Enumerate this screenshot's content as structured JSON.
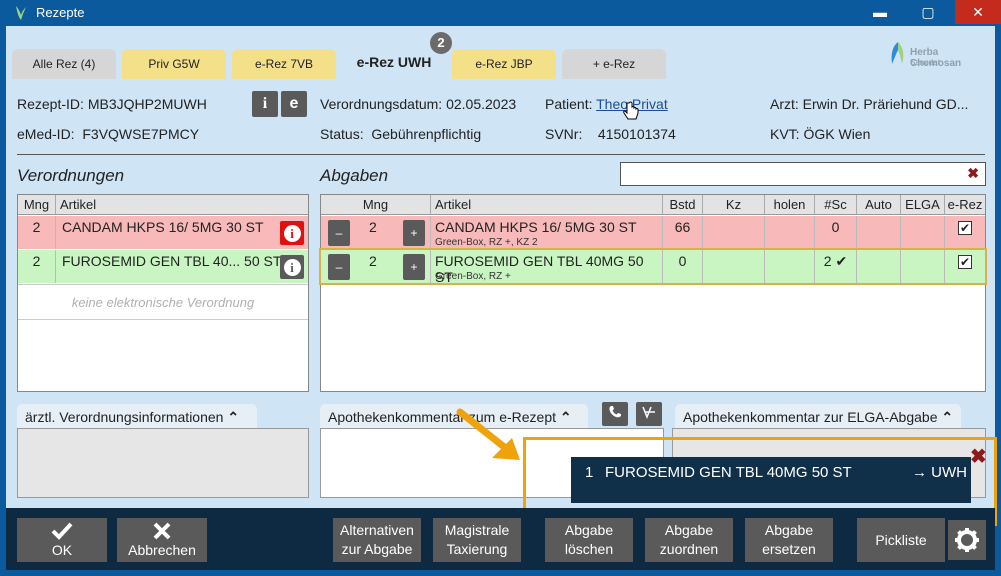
{
  "window": {
    "title": "Rezepte",
    "minimize": "▬",
    "maximize": "▢",
    "close": "✕"
  },
  "tabs": [
    {
      "label": "Alle Rez (4)"
    },
    {
      "label": "Priv G5W"
    },
    {
      "label": "e-Rez 7VB"
    },
    {
      "label": "e-Rez UWH"
    },
    {
      "label": "e-Rez JBP"
    },
    {
      "label": "+ e-Rez"
    }
  ],
  "active_tab_badge": "2",
  "brand": {
    "name": "Herba Chemosan",
    "sub": "Sanodat"
  },
  "header": {
    "rezept_id_label": "Rezept-ID:",
    "rezept_id": "MB3JQHP2MUWH",
    "emed_id_label": "eMed-ID:",
    "emed_id": "F3VQWSE7PMCY",
    "info_btn": "i",
    "e_btn": "e",
    "verordnungsdatum_label": "Verordnungsdatum:",
    "verordnungsdatum": "02.05.2023",
    "status_label": "Status:",
    "status": "Gebührenpflichtig",
    "patient_label": "Patient:",
    "patient": "Theo Privat",
    "svnr_label": "SVNr:",
    "svnr": "4150101374",
    "arzt_label": "Arzt:",
    "arzt": "Erwin Dr. Präriehund GD...",
    "kvt_label": "KVT:",
    "kvt": "ÖGK Wien"
  },
  "verordnungen": {
    "title": "Verordnungen",
    "columns": [
      "Mng",
      "Artikel"
    ],
    "rows": [
      {
        "mng": "2",
        "artikel": "CANDAM HKPS 16/ 5MG 30 ST"
      },
      {
        "mng": "2",
        "artikel": "FUROSEMID GEN TBL 40... 50 ST"
      }
    ],
    "placeholder": "keine elektronische Verordnung"
  },
  "abgaben": {
    "title": "Abgaben",
    "search_value": "",
    "search_clear": "✖",
    "columns": [
      "Mng",
      "Artikel",
      "Bstd",
      "Kz",
      "holen",
      "#Sc",
      "Auto",
      "ELGA",
      "e-Rez"
    ],
    "minus": "–",
    "plus": "+",
    "rows": [
      {
        "mng": "2",
        "artikel": "CANDAM HKPS 16/ 5MG 30 ST",
        "sub": "Green-Box, RZ +, KZ 2",
        "bstd": "66",
        "sc": "0",
        "erez": "✔"
      },
      {
        "mng": "2",
        "artikel": "FUROSEMID GEN TBL 40MG 50 ST",
        "sub": "Green-Box, RZ +",
        "bstd": "0",
        "sc": "2 ✔",
        "erez": "✔"
      }
    ]
  },
  "comments": {
    "arzt": "ärztl. Verordnungsinformationen",
    "apotheke_erez": "Apothekenkommentar zum e-Rezept",
    "apotheke_elga": "Apothekenkommentar zur ELGA-Abgabe",
    "chevron": "⌃"
  },
  "popup": {
    "index": "1",
    "text": "FUROSEMID GEN TBL 40MG 50 ST",
    "target": "→ UWH",
    "close": "✖"
  },
  "buttons": {
    "ok": "OK",
    "cancel": "Abbrechen",
    "alt1": "Alternativen",
    "alt2": "zur Abgabe",
    "mag1": "Magistrale",
    "mag2": "Taxierung",
    "del1": "Abgabe",
    "del2": "löschen",
    "ass1": "Abgabe",
    "ass2": "zuordnen",
    "rep1": "Abgabe",
    "rep2": "ersetzen",
    "pick": "Pickliste"
  },
  "colors": {
    "accent": "#0b5a9e",
    "highlight": "#f0a20a",
    "red_row": "#f7b9b9",
    "green_row": "#c9f5c2"
  }
}
